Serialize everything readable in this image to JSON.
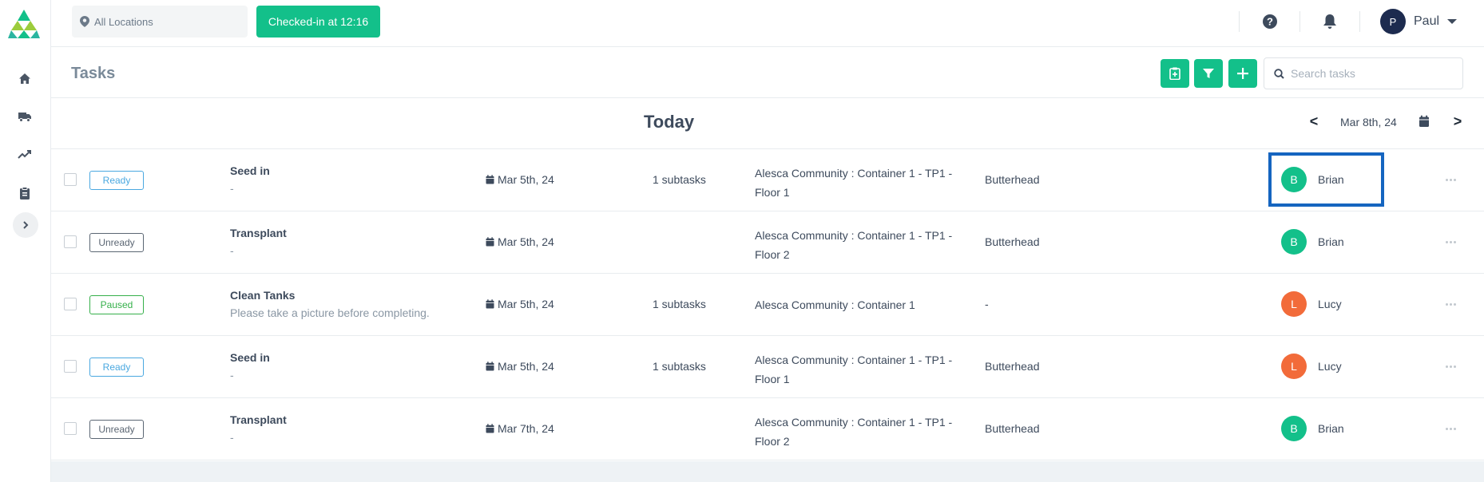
{
  "topbar": {
    "location_placeholder": "All Locations",
    "checkin_label": "Checked-in at 12:16",
    "user": {
      "initial": "P",
      "name": "Paul"
    }
  },
  "sidebar": {
    "items": [
      {
        "icon": "home-icon"
      },
      {
        "icon": "truck-icon"
      },
      {
        "icon": "trend-icon"
      },
      {
        "icon": "clipboard-icon"
      }
    ]
  },
  "header": {
    "title": "Tasks",
    "search_placeholder": "Search tasks"
  },
  "day": {
    "title": "Today",
    "prev": "<",
    "next": ">",
    "date": "Mar 8th, 24"
  },
  "colors": {
    "accent": "#13c08a",
    "brian": "#13c08a",
    "lucy": "#f26b3a",
    "highlight": "#1565c0"
  },
  "tasks": [
    {
      "status": "Ready",
      "status_key": "ready",
      "name": "Seed in",
      "desc": "-",
      "date": "Mar 5th, 24",
      "subtasks": "1 subtasks",
      "location": "Alesca Community : Container 1 - TP1 - Floor 1",
      "crop": "Butterhead",
      "assignee_initial": "B",
      "assignee": "Brian"
    },
    {
      "status": "Unready",
      "status_key": "unready",
      "name": "Transplant",
      "desc": "-",
      "date": "Mar 5th, 24",
      "subtasks": "",
      "location": "Alesca Community : Container 1 - TP1 - Floor 2",
      "crop": "Butterhead",
      "assignee_initial": "B",
      "assignee": "Brian"
    },
    {
      "status": "Paused",
      "status_key": "paused",
      "name": "Clean Tanks",
      "desc": "Please take a picture before completing.",
      "date": "Mar 5th, 24",
      "subtasks": "1 subtasks",
      "location": "Alesca Community : Container 1",
      "crop": "-",
      "assignee_initial": "L",
      "assignee": "Lucy"
    },
    {
      "status": "Ready",
      "status_key": "ready",
      "name": "Seed in",
      "desc": "-",
      "date": "Mar 5th, 24",
      "subtasks": "1 subtasks",
      "location": "Alesca Community : Container 1 - TP1 - Floor 1",
      "crop": "Butterhead",
      "assignee_initial": "L",
      "assignee": "Lucy"
    },
    {
      "status": "Unready",
      "status_key": "unready",
      "name": "Transplant",
      "desc": "-",
      "date": "Mar 7th, 24",
      "subtasks": "",
      "location": "Alesca Community : Container 1 - TP1 - Floor 2",
      "crop": "Butterhead",
      "assignee_initial": "B",
      "assignee": "Brian"
    }
  ]
}
